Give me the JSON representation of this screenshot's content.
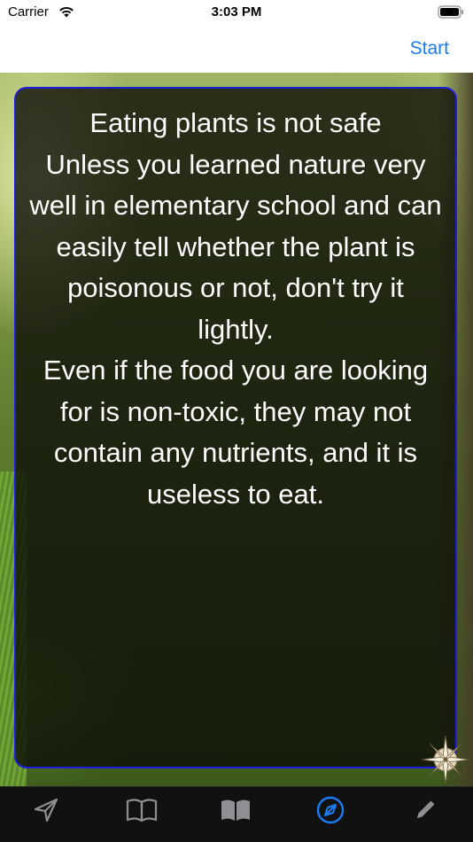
{
  "status_bar": {
    "carrier": "Carrier",
    "time": "3:03 PM"
  },
  "nav": {
    "right_button": "Start"
  },
  "card": {
    "text": "Eating plants is not safe\nUnless you learned nature very well in elementary school and can easily tell whether the plant is poisonous or not, don't try it lightly.\nEven if the food you are looking for is non-toxic, they may not contain any nutrients, and it is useless to eat."
  },
  "tabs": [
    {
      "icon": "send-icon",
      "selected": false
    },
    {
      "icon": "book-open-icon",
      "selected": false
    },
    {
      "icon": "book-filled-icon",
      "selected": false
    },
    {
      "icon": "compass-icon",
      "selected": true
    },
    {
      "icon": "pencil-icon",
      "selected": false
    }
  ],
  "colors": {
    "accent": "#1a7cf5",
    "tab_inactive": "#8e8e93",
    "card_border": "#1d1ddc",
    "tab_bar_bg": "#111111"
  }
}
